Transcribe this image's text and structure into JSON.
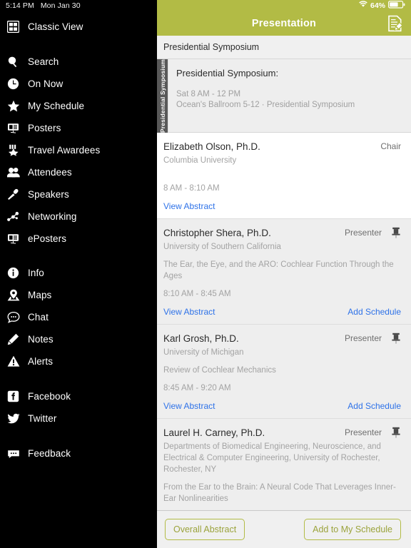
{
  "status_bar": {
    "time": "5:14 PM",
    "date": "Mon Jan 30",
    "battery": "64%",
    "wifi_icon": "wifi-icon",
    "battery_icon": "battery-icon"
  },
  "sidebar": {
    "groups": [
      {
        "items": [
          {
            "label": "Classic View",
            "icon": "grid-icon"
          }
        ]
      },
      {
        "items": [
          {
            "label": "Search",
            "icon": "search-icon"
          },
          {
            "label": "On Now",
            "icon": "clock-icon"
          },
          {
            "label": "My Schedule",
            "icon": "star-icon"
          },
          {
            "label": "Posters",
            "icon": "poster-icon"
          },
          {
            "label": "Travel Awardees",
            "icon": "award-icon"
          },
          {
            "label": "Attendees",
            "icon": "people-icon"
          },
          {
            "label": "Speakers",
            "icon": "microphone-icon"
          },
          {
            "label": "Networking",
            "icon": "network-icon"
          },
          {
            "label": "ePosters",
            "icon": "eposter-icon"
          }
        ]
      },
      {
        "items": [
          {
            "label": "Info",
            "icon": "info-icon"
          },
          {
            "label": "Maps",
            "icon": "map-pin-icon"
          },
          {
            "label": "Chat",
            "icon": "chat-icon"
          },
          {
            "label": "Notes",
            "icon": "pencil-icon"
          },
          {
            "label": "Alerts",
            "icon": "warning-icon"
          }
        ]
      },
      {
        "items": [
          {
            "label": "Facebook",
            "icon": "facebook-icon"
          },
          {
            "label": "Twitter",
            "icon": "twitter-icon"
          }
        ]
      },
      {
        "items": [
          {
            "label": "Feedback",
            "icon": "feedback-icon"
          }
        ]
      }
    ]
  },
  "navbar": {
    "title": "Presentation",
    "note_icon": "note-edit-icon"
  },
  "breadcrumb": "Presidential Symposium",
  "session": {
    "vertical_tab": "Presidential Symposium",
    "title": "Presidential Symposium:",
    "time": "Sat 8 AM - 12 PM",
    "location": "Ocean's Ballroom 5-12 · Presidential Symposium"
  },
  "entries": [
    {
      "name": "Elizabeth Olson, Ph.D.",
      "role": "Chair",
      "affiliation": "Columbia University",
      "presentation_title": "",
      "time": "8 AM - 8:10 AM",
      "view_abstract": "View Abstract",
      "add_schedule": "",
      "has_pin": false,
      "background": "white"
    },
    {
      "name": "Christopher Shera, Ph.D.",
      "role": "Presenter",
      "affiliation": "University of Southern California",
      "presentation_title": "The Ear, the Eye, and the ARO: Cochlear Function Through the Ages",
      "time": "8:10 AM - 8:45 AM",
      "view_abstract": "View Abstract",
      "add_schedule": "Add Schedule",
      "has_pin": true,
      "background": "grey"
    },
    {
      "name": "Karl Grosh, Ph.D.",
      "role": "Presenter",
      "affiliation": "University of Michigan",
      "presentation_title": "Review of Cochlear Mechanics",
      "time": "8:45 AM - 9:20 AM",
      "view_abstract": "View Abstract",
      "add_schedule": "Add Schedule",
      "has_pin": true,
      "background": "grey"
    },
    {
      "name": "Laurel H. Carney, Ph.D.",
      "role": "Presenter",
      "affiliation": "Departments of Biomedical Engineering, Neuroscience, and Electrical & Computer Engineering, University of Rochester, Rochester, NY",
      "presentation_title": "From the Ear to the Brain: A Neural Code That Leverages Inner-Ear Nonlinearities",
      "time": "",
      "view_abstract": "",
      "add_schedule": "",
      "has_pin": true,
      "background": "grey"
    }
  ],
  "toolbar": {
    "overall_abstract": "Overall Abstract",
    "add_to_my_schedule": "Add to My Schedule"
  },
  "colors": {
    "accent": "#b2bb45",
    "link": "#2e72e8",
    "sidebar_bg": "#000000",
    "main_bg": "#f0f0f0",
    "vtab_bg": "#585858"
  }
}
